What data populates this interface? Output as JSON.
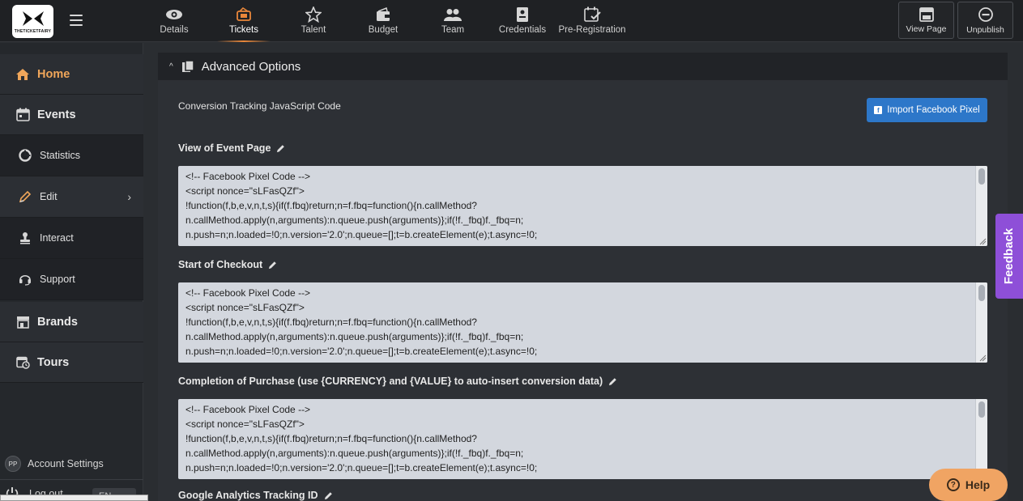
{
  "brand": {
    "logo_text": "THETICKETFAIRY"
  },
  "nav": {
    "tabs": [
      {
        "label": "Details",
        "icon": "eye-icon"
      },
      {
        "label": "Tickets",
        "icon": "ticket-icon"
      },
      {
        "label": "Talent",
        "icon": "star-icon"
      },
      {
        "label": "Budget",
        "icon": "wallet-icon"
      },
      {
        "label": "Team",
        "icon": "people-icon"
      },
      {
        "label": "Credentials",
        "icon": "badge-icon"
      },
      {
        "label": "Pre-Registration",
        "icon": "calendar-check-icon"
      }
    ],
    "active_tab": "Tickets",
    "view_page_label": "View Page",
    "unpublish_label": "Unpublish"
  },
  "sidebar": {
    "home": "Home",
    "events": "Events",
    "statistics": "Statistics",
    "edit": "Edit",
    "interact": "Interact",
    "support": "Support",
    "brands": "Brands",
    "tours": "Tours",
    "account_initials": "PP",
    "account_settings": "Account Settings",
    "logout": "Log out",
    "language": "EN"
  },
  "panel": {
    "title": "Advanced Options",
    "conversion_label": "Conversion Tracking JavaScript Code",
    "import_button": "Import Facebook Pixel",
    "fields": [
      {
        "label": "View of Event Page"
      },
      {
        "label": "Start of Checkout"
      },
      {
        "label": "Completion of Purchase (use {CURRENCY} and {VALUE} to auto-insert conversion data)"
      },
      {
        "label": "Google Analytics Tracking ID"
      }
    ],
    "code_lines": [
      "<!-- Facebook Pixel Code -->",
      "<script nonce=\"sLFasQZf\">",
      "!function(f,b,e,v,n,t,s){if(f.fbq)return;n=f.fbq=function(){n.callMethod?",
      "n.callMethod.apply(n,arguments):n.queue.push(arguments)};if(!f._fbq)f._fbq=n;",
      "n.push=n;n.loaded=!0;n.version='2.0';n.queue=[];t=b.createElement(e);t.async=!0;"
    ]
  },
  "widgets": {
    "feedback": "Feedback",
    "help": "Help"
  },
  "colors": {
    "accent_orange": "#f0a65a",
    "button_blue": "#2d77c9",
    "feedback_purple": "#8e4fd8",
    "help_orange": "#f0a463"
  }
}
